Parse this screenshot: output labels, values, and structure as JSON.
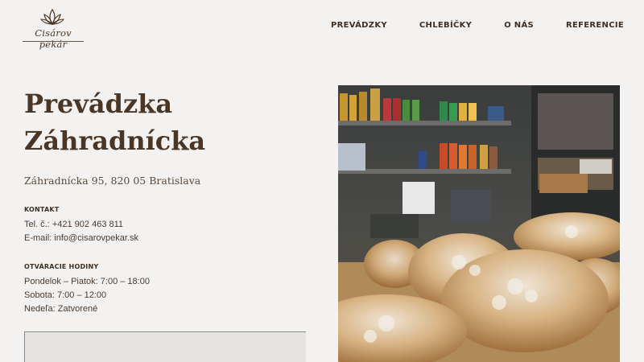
{
  "brand": {
    "logo_text": "Cisárov pekár",
    "logo_icon": "lotus-leaf-icon"
  },
  "nav": {
    "items": [
      "PREVÁDZKY",
      "CHLEBÍČKY",
      "O NÁS",
      "REFERENCIE"
    ]
  },
  "main": {
    "title_line1": "Prevádzka",
    "title_line2": "Záhradnícka",
    "address": "Záhradnícka 95, 820 05 Bratislava",
    "contact": {
      "heading": "KONTAKT",
      "phone": "Tel. č.: +421 902 463 811",
      "email": "E-mail: info@cisarovpekar.sk"
    },
    "hours": {
      "heading": "OTVÁRACIE HODINY",
      "weekdays": "Pondelok – Piatok: 7:00 – 18:00",
      "saturday": "Sobota: 7:00 – 12:00",
      "sunday": "Nedeľa: Zatvorené"
    }
  },
  "photo": {
    "subject": "pastries-on-counter"
  },
  "colors": {
    "background": "#f4f2f0",
    "text": "#3e2f22",
    "title": "#4a3626"
  }
}
